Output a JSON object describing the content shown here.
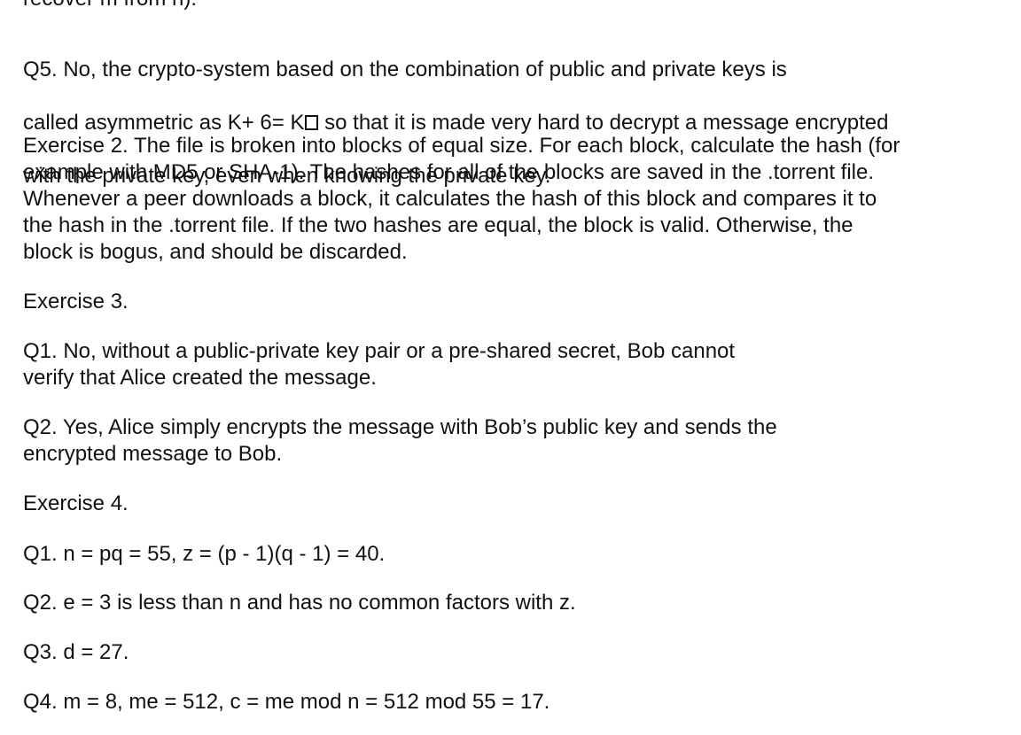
{
  "top_fragment": "recover m from n).",
  "paragraphs": {
    "q5_line1": "Q5. No, the crypto-system based on the combination of public and private keys is",
    "q5_line2_pre": "called asymmetric as K+ 6= K",
    "q5_line2_post": " so that it is made very hard to decrypt a message encrypted",
    "q5_line3": "with the private key, even when knowing the private key.",
    "ex2": "Exercise 2. The file is broken into blocks of equal size. For each block, calculate the hash (for\nexample with MD5 or SHA-1). The hashes for all of the blocks are saved in the .torrent file.\nWhenever a peer downloads a block, it calculates the hash of this block and compares it to\nthe hash in the .torrent file. If the two hashes are equal, the block is valid. Otherwise, the\nblock is bogus, and should be discarded.",
    "ex3_title": "Exercise 3.",
    "ex3_q1": "Q1. No, without a public-private key pair or a pre-shared secret, Bob cannot\nverify that Alice created the message.",
    "ex3_q2": "Q2. Yes, Alice simply encrypts the message with Bob’s public key and sends the\nencrypted message to Bob.",
    "ex4_title": "Exercise 4.",
    "ex4_q1": "Q1. n = pq = 55, z = (p - 1)(q - 1) = 40.",
    "ex4_q2": "Q2. e = 3 is less than n and has no common factors with z.",
    "ex4_q3": "Q3. d = 27.",
    "ex4_q4": "Q4. m = 8, me = 512, c = me mod n = 512 mod 55 = 17."
  }
}
